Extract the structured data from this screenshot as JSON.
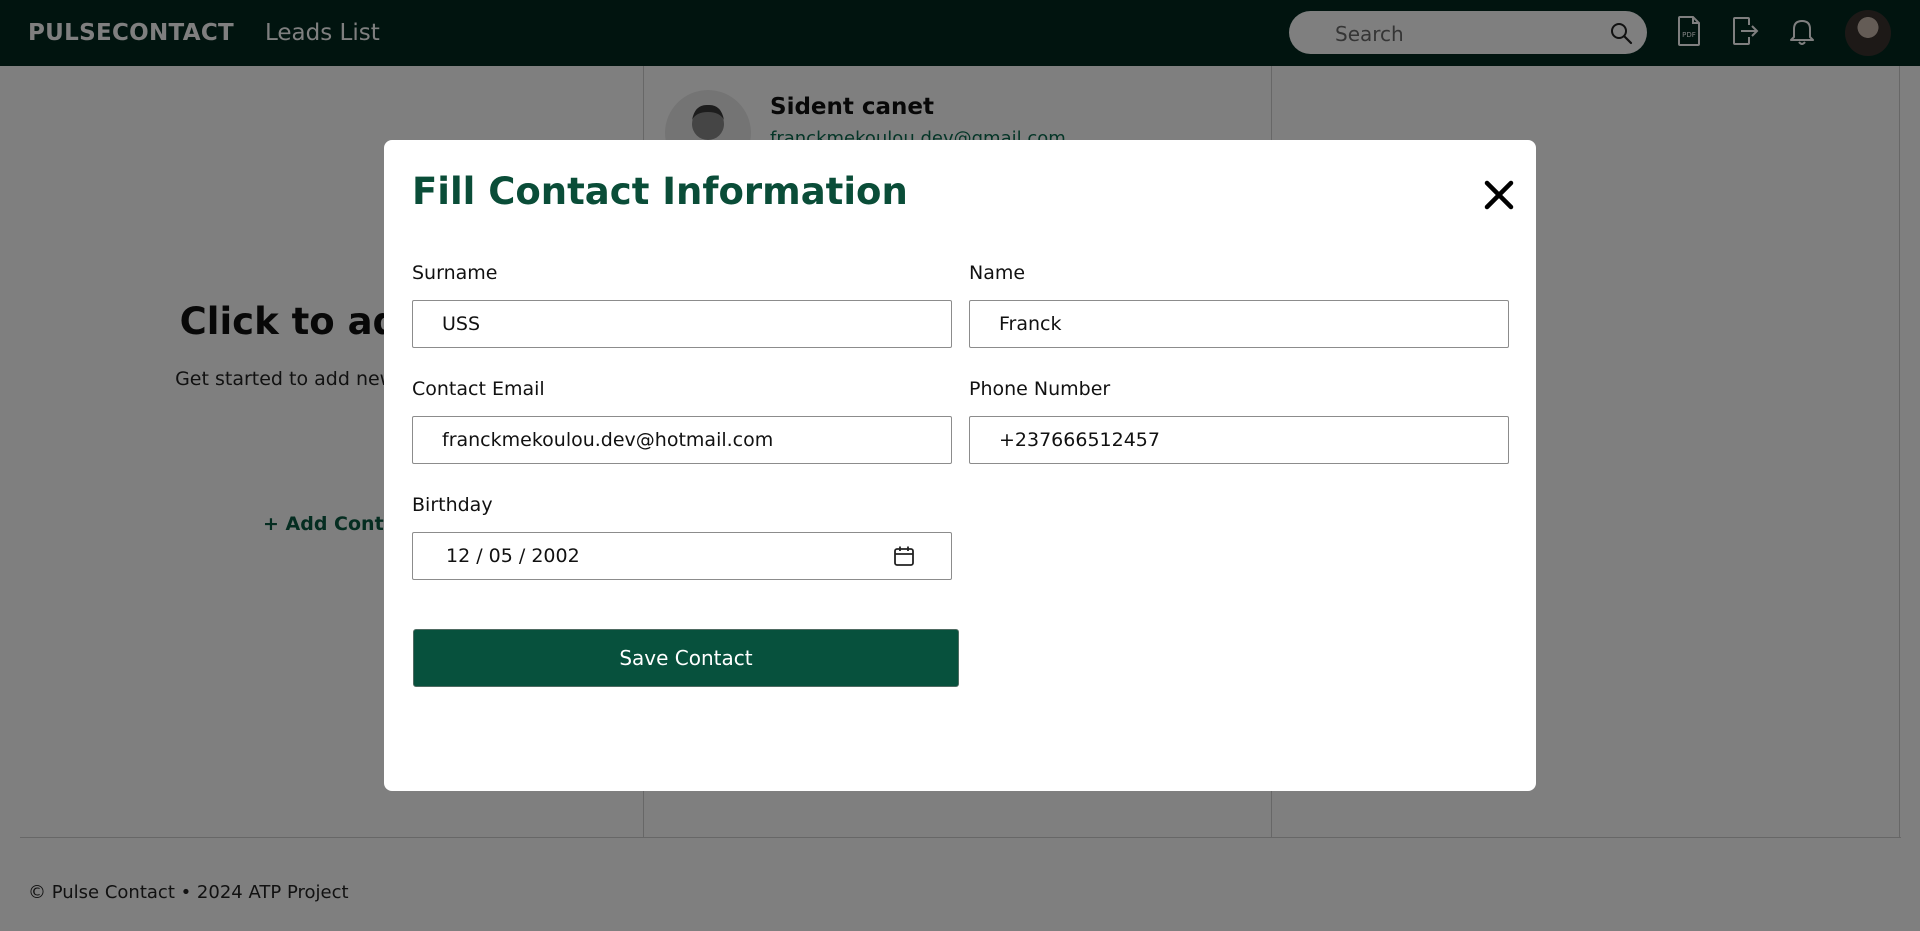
{
  "header": {
    "brand": "PULSECONTACT",
    "nav_link": "Leads List",
    "search_placeholder": "Search"
  },
  "background": {
    "add_title": "Click to add c",
    "add_subtitle": "Get started to add new contac",
    "add_link": "+ Add Contac",
    "card_name": "Sident canet",
    "card_email": "franckmekoulou.dev@gmail.com"
  },
  "modal": {
    "title": "Fill Contact Information",
    "fields": {
      "surname": {
        "label": "Surname",
        "value": "USS"
      },
      "name": {
        "label": "Name",
        "value": "Franck"
      },
      "email": {
        "label": "Contact Email",
        "value": "franckmekoulou.dev@hotmail.com"
      },
      "phone": {
        "label": "Phone Number",
        "value": "+237666512457"
      },
      "birthday": {
        "label": "Birthday",
        "value": "12 / 05 / 2002"
      }
    },
    "save_label": "Save Contact"
  },
  "footer": {
    "text": "© Pulse Contact • 2024 ATP Project"
  },
  "icons": {
    "search": "search-icon",
    "pdf": "pdf-icon",
    "logout": "logout-icon",
    "notifications": "bell-icon",
    "close": "close-icon",
    "calendar": "calendar-icon"
  },
  "colors": {
    "header_bg": "#02281e",
    "accent": "#0a4d38",
    "button_bg": "#07513d"
  }
}
